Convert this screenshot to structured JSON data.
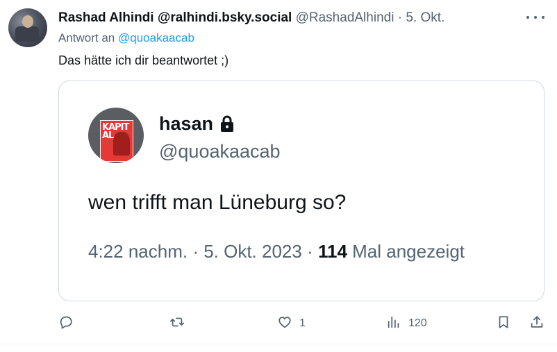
{
  "post": {
    "author_name": "Rashad Alhindi @ralhindi.bsky.social",
    "author_handle": "@RashadAlhindi",
    "separator": "·",
    "date": "5. Okt.",
    "reply_prefix": "Antwort an",
    "reply_handle": "@quoakaacab",
    "text": "Das hätte ich dir beantwortet ;)"
  },
  "quoted": {
    "name": "hasan",
    "handle": "@quoakaacab",
    "text": "wen trifft man Lüneburg so?",
    "timestamp": "4:22 nachm. · 5. Okt. 2023 ·",
    "views": "114",
    "views_label": "Mal angezeigt",
    "avatar_text": "KAPITAL"
  },
  "actions": {
    "reply_count": "",
    "repost_count": "",
    "like_count": "1",
    "views_count": "120"
  },
  "colors": {
    "text": "#0f1419",
    "secondary": "#536471",
    "link": "#1d9bf0",
    "border": "#cfd9de"
  },
  "icons": [
    "more-icon",
    "lock-icon",
    "reply-icon",
    "repost-icon",
    "like-icon",
    "views-icon",
    "bookmark-icon",
    "share-icon"
  ]
}
